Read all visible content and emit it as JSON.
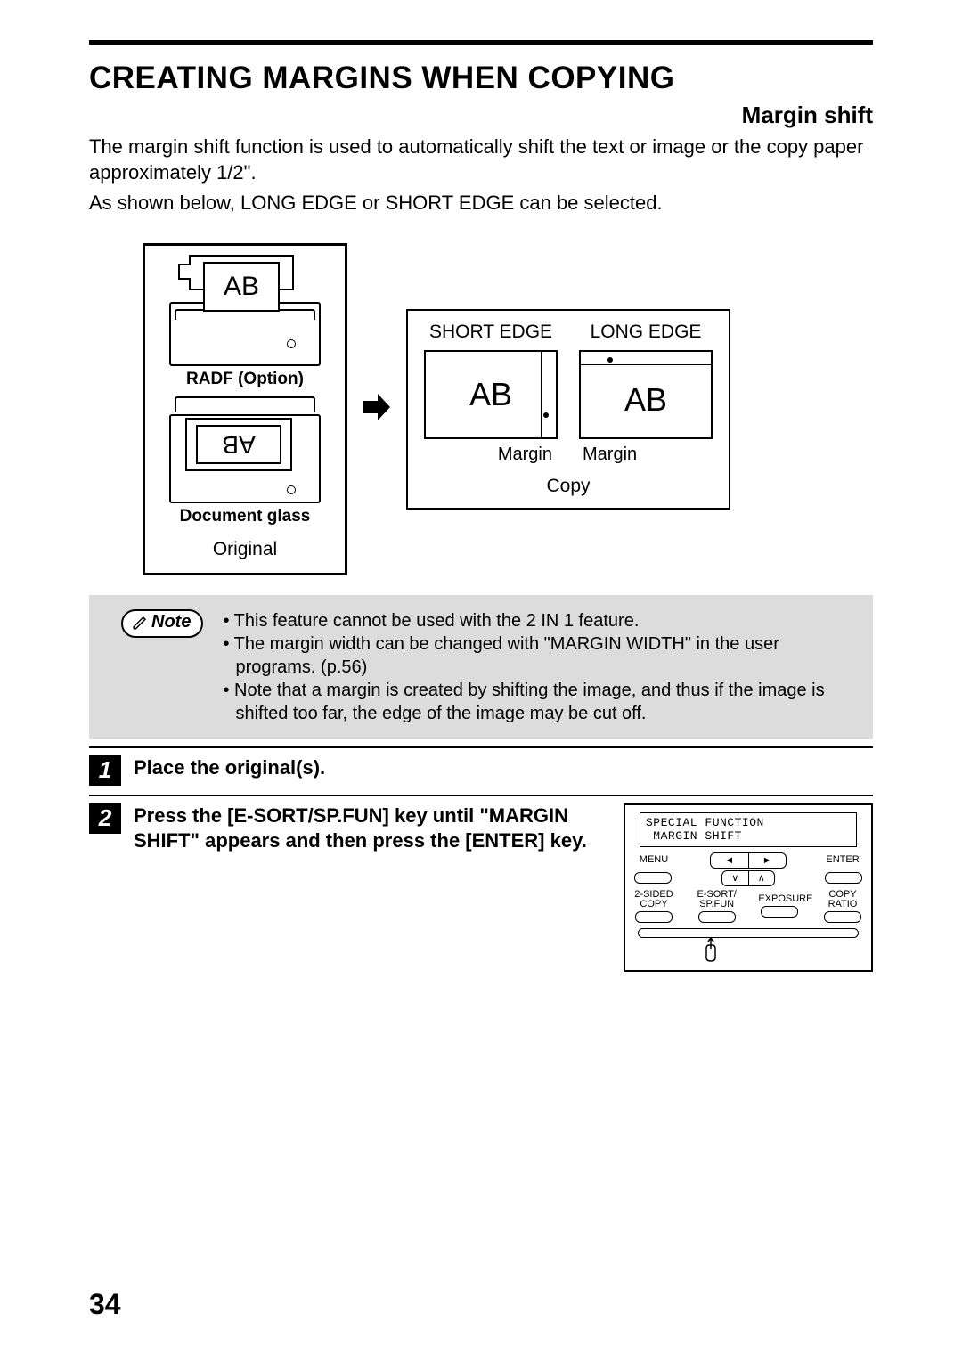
{
  "title": "CREATING MARGINS WHEN COPYING",
  "subtitle": "Margin shift",
  "intro1": "The margin shift function is used to automatically shift the text or image or the copy paper approximately 1/2\".",
  "intro2": "As shown below, LONG EDGE or SHORT EDGE can be selected.",
  "diagram": {
    "ab": "AB",
    "radf": "RADF (Option)",
    "docglass": "Document glass",
    "original": "Original",
    "short_edge": "SHORT EDGE",
    "long_edge": "LONG EDGE",
    "margin": "Margin",
    "copy": "Copy"
  },
  "note": {
    "label": "Note",
    "items": [
      "This feature cannot be used with the 2 IN 1 feature.",
      "The margin width can be changed with \"MARGIN WIDTH\" in the user programs. (p.56)",
      "Note that a margin is created by shifting the image, and thus if the image is shifted too far, the edge of the image may be cut off."
    ]
  },
  "steps": {
    "s1_num": "1",
    "s1_text": "Place the original(s).",
    "s2_num": "2",
    "s2_text": "Press the [E-SORT/SP.FUN] key until \"MARGIN SHIFT\" appears and then press the [ENTER] key."
  },
  "panel": {
    "lcd1": "SPECIAL FUNCTION",
    "lcd2": " MARGIN SHIFT",
    "menu": "MENU",
    "enter": "ENTER",
    "b1": "2-SIDED\nCOPY",
    "b2": "E-SORT/\nSP.FUN",
    "b3": "EXPOSURE",
    "b4": "COPY\nRATIO"
  },
  "page": "34"
}
